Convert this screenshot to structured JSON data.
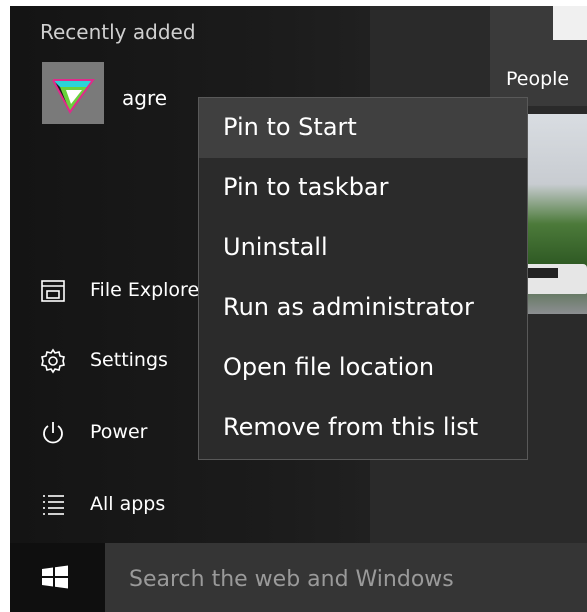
{
  "start_menu": {
    "recently_added_title": "Recently added",
    "recent_apps": [
      {
        "label": "agre",
        "icon": "agre-app-icon"
      }
    ],
    "nav": [
      {
        "label": "File Explorer",
        "icon": "file-explorer-icon"
      },
      {
        "label": "Settings",
        "icon": "settings-gear-icon"
      },
      {
        "label": "Power",
        "icon": "power-icon"
      },
      {
        "label": "All apps",
        "icon": "all-apps-list-icon"
      }
    ],
    "tiles": {
      "people_label": "People"
    }
  },
  "context_menu": {
    "items": [
      {
        "label": "Pin to Start",
        "highlighted": true
      },
      {
        "label": "Pin to taskbar",
        "highlighted": false
      },
      {
        "label": "Uninstall",
        "highlighted": false
      },
      {
        "label": "Run as administrator",
        "highlighted": false
      },
      {
        "label": "Open file location",
        "highlighted": false
      },
      {
        "label": "Remove from this list",
        "highlighted": false
      }
    ]
  },
  "taskbar": {
    "search_placeholder": "Search the web and Windows",
    "start_icon": "windows-logo-icon"
  },
  "colors": {
    "menu_bg": "#2b2b2b",
    "menu_highlight": "#404040",
    "menu_border": "#595959",
    "start_bg": "#1a1a1a",
    "search_bg": "#353535"
  }
}
